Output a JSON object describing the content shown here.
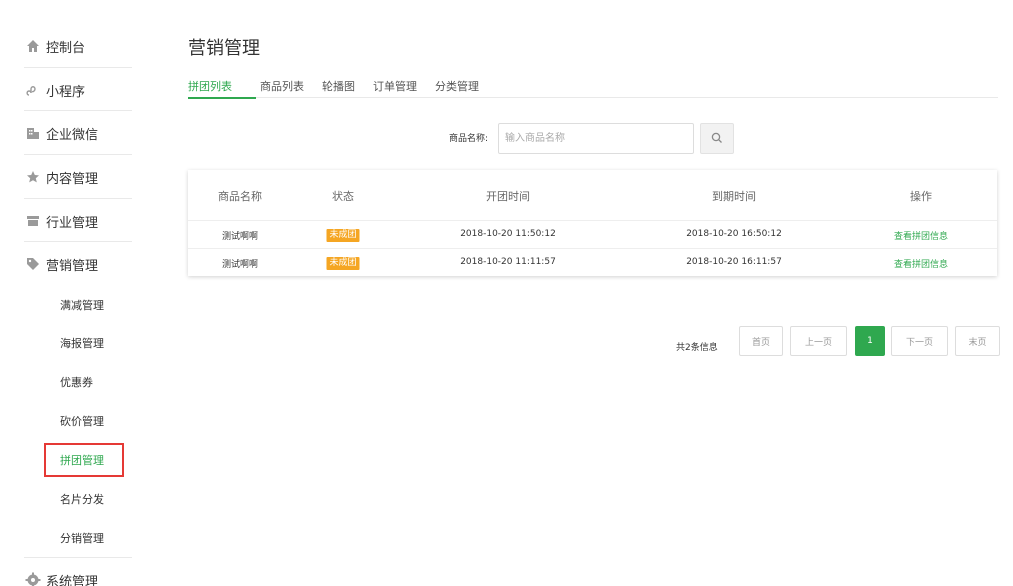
{
  "sidebar": {
    "items": [
      {
        "label": "控制台",
        "icon": "home-icon"
      },
      {
        "label": "小程序",
        "icon": "mini-program-icon"
      },
      {
        "label": "企业微信",
        "icon": "enterprise-wechat-icon"
      },
      {
        "label": "内容管理",
        "icon": "star-icon"
      },
      {
        "label": "行业管理",
        "icon": "store-icon"
      },
      {
        "label": "营销管理",
        "icon": "tag-icon"
      }
    ],
    "sub_items": [
      "满减管理",
      "海报管理",
      "优惠券",
      "砍价管理",
      "拼团管理",
      "名片分发",
      "分销管理"
    ],
    "active_sub_index": 4,
    "bottom_item": {
      "label": "系统管理",
      "icon": "gear-icon"
    }
  },
  "page_title": "营销管理",
  "tabs": [
    "拼团列表",
    "商品列表",
    "轮播图",
    "订单管理",
    "分类管理"
  ],
  "active_tab_index": 0,
  "search": {
    "label": "商品名称:",
    "placeholder": "输入商品名称",
    "button_icon": "search-icon"
  },
  "table": {
    "headers": [
      "商品名称",
      "状态",
      "开团时间",
      "到期时间",
      "操作"
    ],
    "rows": [
      {
        "name": "测试啊啊",
        "status": "未成团",
        "start": "2018-10-20 11:50:12",
        "end": "2018-10-20 16:50:12",
        "action": "查看拼团信息"
      },
      {
        "name": "测试啊啊",
        "status": "未成团",
        "start": "2018-10-20 11:11:57",
        "end": "2018-10-20 16:11:57",
        "action": "查看拼团信息"
      }
    ]
  },
  "pagination": {
    "total_text": "共2条信息",
    "first": "首页",
    "prev": "上一页",
    "current": "1",
    "next": "下一页",
    "last": "末页"
  },
  "colors": {
    "accent": "#2fa84f",
    "badge": "#f5a623",
    "highlight_box": "#e53935"
  }
}
